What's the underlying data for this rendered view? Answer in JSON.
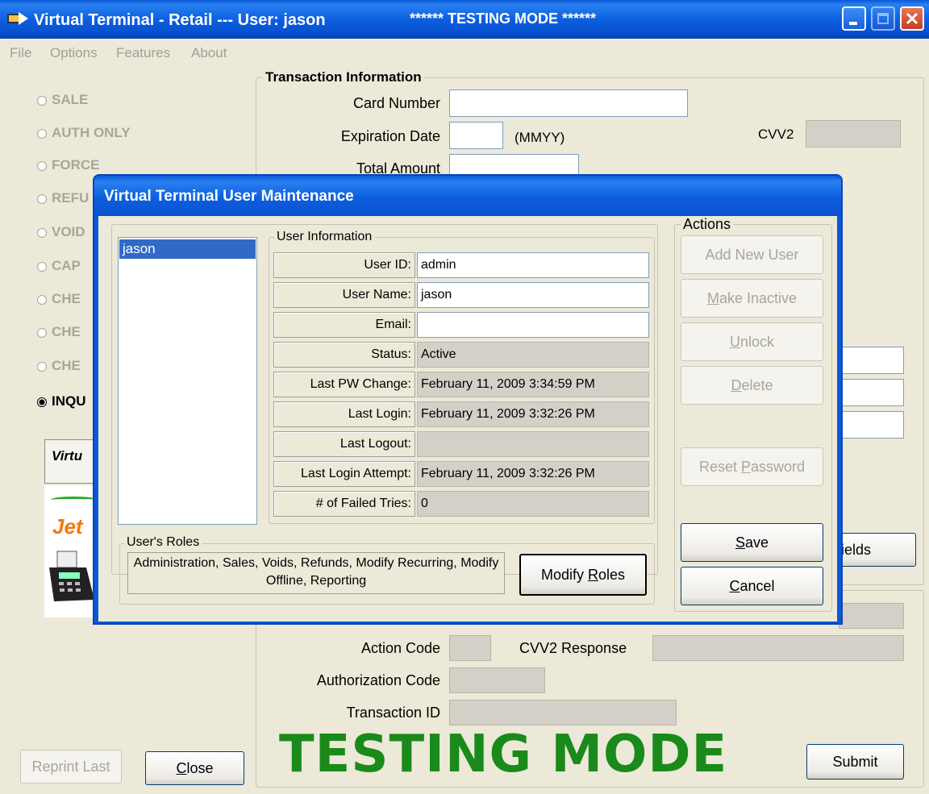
{
  "window": {
    "title": "Virtual Terminal - Retail --- User: jason",
    "mode_banner": "****** TESTING MODE ******"
  },
  "menu": [
    "File",
    "Options",
    "Features",
    "About"
  ],
  "transaction_types": [
    {
      "label": "SALE",
      "checked": false
    },
    {
      "label": "AUTH ONLY",
      "checked": false
    },
    {
      "label": "FORCE",
      "checked": false
    },
    {
      "label": "REFU",
      "checked": false
    },
    {
      "label": "VOID",
      "checked": false
    },
    {
      "label": "CAP",
      "checked": false
    },
    {
      "label": "CHE",
      "checked": false
    },
    {
      "label": "CHE",
      "checked": false
    },
    {
      "label": "CHE",
      "checked": false
    },
    {
      "label": "INQU",
      "checked": true
    }
  ],
  "logo_panel": {
    "title": "Virtu",
    "brand": "Jet"
  },
  "transaction_info": {
    "legend": "Transaction Information",
    "card_number_label": "Card Number",
    "expiration_label": "Expiration Date",
    "expiration_hint": "(MMYY)",
    "cvv2_label": "CVV2",
    "total_amount_label": "Total Amount"
  },
  "response": {
    "action_code_label": "Action Code",
    "cvv2_response_label": "CVV2 Response",
    "auth_code_label": "Authorization Code",
    "transaction_id_label": "Transaction ID",
    "fields_button_partial": "ields"
  },
  "testing_mode_text": "TESTING MODE",
  "bottom_buttons": {
    "reprint_last": "Reprint Last",
    "close_pre": "",
    "close_u": "C",
    "close_post": "lose",
    "submit": "Submit"
  },
  "dialog": {
    "title": "Virtual Terminal User Maintenance",
    "users": [
      "jason"
    ],
    "user_info_legend": "User Information",
    "fields": [
      {
        "label": "User ID:",
        "value": "admin",
        "editable": true
      },
      {
        "label": "User Name:",
        "value": "jason",
        "editable": true
      },
      {
        "label": "Email:",
        "value": "",
        "editable": true
      },
      {
        "label": "Status:",
        "value": "Active",
        "editable": false
      },
      {
        "label": "Last PW Change:",
        "value": "February 11, 2009 3:34:59 PM",
        "editable": false
      },
      {
        "label": "Last Login:",
        "value": "February 11, 2009 3:32:26 PM",
        "editable": false
      },
      {
        "label": "Last Logout:",
        "value": "",
        "editable": false
      },
      {
        "label": "Last Login Attempt:",
        "value": "February 11, 2009 3:32:26 PM",
        "editable": false
      },
      {
        "label": "# of Failed Tries:",
        "value": "0",
        "editable": false
      }
    ],
    "roles_legend": "User's Roles",
    "roles_text": "Administration, Sales, Voids, Refunds, Modify Recurring, Modify Offline, Reporting",
    "modify_roles": {
      "pre": "Modify ",
      "u": "R",
      "post": "oles"
    },
    "actions_legend": "Actions",
    "actions": {
      "add_new_user": "Add New User",
      "make_inactive": {
        "pre": "",
        "u": "M",
        "post": "ake Inactive"
      },
      "unlock": {
        "pre": "",
        "u": "U",
        "post": "nlock"
      },
      "delete": {
        "pre": "",
        "u": "D",
        "post": "elete"
      },
      "reset_password": {
        "pre": "Reset ",
        "u": "P",
        "post": "assword"
      },
      "save": {
        "pre": "",
        "u": "S",
        "post": "ave"
      },
      "cancel": {
        "pre": "",
        "u": "C",
        "post": "ancel"
      }
    }
  },
  "colors": {
    "titlebar": "#0a5ad8",
    "window_bg": "#ece9d8",
    "testing_green": "#1a8a1a",
    "selection": "#316ac5"
  }
}
